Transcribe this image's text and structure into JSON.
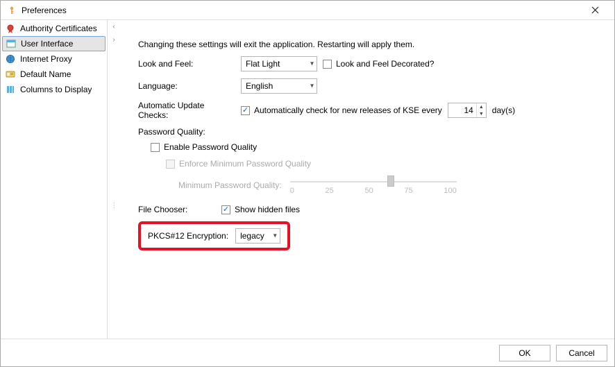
{
  "window": {
    "title": "Preferences",
    "close_label": "✕"
  },
  "sidebar": {
    "items": [
      {
        "label": "Authority Certificates"
      },
      {
        "label": "User Interface"
      },
      {
        "label": "Internet Proxy"
      },
      {
        "label": "Default Name"
      },
      {
        "label": "Columns to Display"
      }
    ],
    "selected_index": 1
  },
  "content": {
    "info": "Changing these settings will exit the application.  Restarting will apply them.",
    "look_and_feel": {
      "label": "Look and Feel:",
      "value": "Flat Light",
      "decorated_label": "Look and Feel Decorated?",
      "decorated_checked": false
    },
    "language": {
      "label": "Language:",
      "value": "English"
    },
    "updates": {
      "label": "Automatic Update Checks:",
      "checkbox_label": "Automatically check for new releases of KSE every",
      "checked": true,
      "days_value": "14",
      "days_suffix": "day(s)"
    },
    "password": {
      "header": "Password Quality:",
      "enable_label": "Enable Password Quality",
      "enable_checked": false,
      "enforce_label": "Enforce Minimum Password Quality",
      "min_label": "Minimum Password Quality:",
      "ticks": [
        "0",
        "25",
        "50",
        "75",
        "100"
      ]
    },
    "file_chooser": {
      "label": "File Chooser:",
      "checkbox_label": "Show hidden files",
      "checked": true
    },
    "pkcs12": {
      "label": "PKCS#12 Encryption:",
      "value": "legacy"
    }
  },
  "footer": {
    "ok": "OK",
    "cancel": "Cancel"
  }
}
